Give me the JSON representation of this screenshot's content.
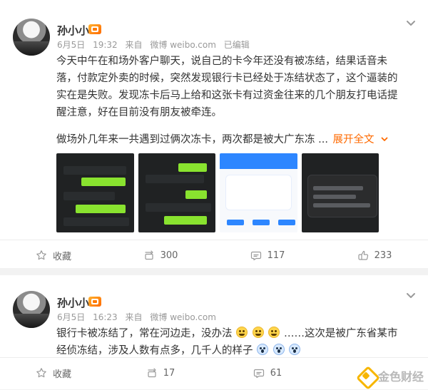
{
  "posts": [
    {
      "user": {
        "name": "孙小小"
      },
      "meta": {
        "date": "6月5日",
        "time": "19:32",
        "from_prefix": "来自",
        "source": "微博 weibo.com",
        "status": "已编辑"
      },
      "content": {
        "p1": "今天中午在和场外客户聊天，说自己的卡今年还没有被冻结，结果话音未落，付款定外卖的时候，突然发现银行卡已经处于冻结状态了，这个逼装的实在是失败。发现冻卡后马上给和这张卡有过资金往来的几个朋友打电话提醒注意，好在目前没有朋友被牵连。",
        "p2": "做场外几年来一共遇到过俩次冻卡，两次都是被大广东冻 ...",
        "expand_label": "展开全文",
        "expand_icon": "chevron-down-icon"
      },
      "actions": {
        "collect": {
          "icon": "star-icon",
          "label": "收藏"
        },
        "repost": {
          "icon": "repost-icon",
          "label": "300"
        },
        "comment": {
          "icon": "comment-icon",
          "label": "117"
        },
        "like": {
          "icon": "thumbs-up-icon",
          "label": "233"
        }
      }
    },
    {
      "user": {
        "name": "孙小小"
      },
      "meta": {
        "date": "6月5日",
        "time": "16:23",
        "from_prefix": "来自",
        "source": "微博 weibo.com"
      },
      "content": {
        "line_prefix": "银行卡被冻结了，常在河边走，没办法",
        "line_suffix": "……这次是被广东省某市经侦冻结，涉及人数有点多，几千人的样子",
        "emoji_names": [
          "tear-laugh-emoji",
          "tear-laugh-emoji",
          "tear-laugh-emoji",
          "shock-emoji",
          "shock-emoji",
          "shock-emoji"
        ]
      },
      "actions": {
        "collect": {
          "icon": "star-icon",
          "label": "收藏"
        },
        "repost": {
          "icon": "repost-icon",
          "label": "17"
        },
        "comment": {
          "icon": "comment-icon",
          "label": "61"
        }
      }
    }
  ],
  "watermark": {
    "text": "金色财经"
  }
}
